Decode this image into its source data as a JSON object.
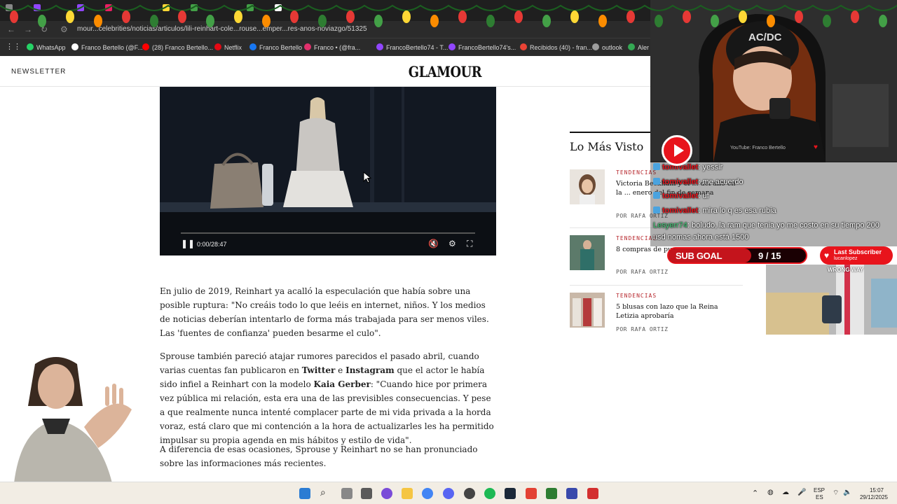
{
  "browser": {
    "url": "mour...celebrities/noticias/articulos/lili-reinhart-cole...rouse...emper...res-anos-noviazgo/51325",
    "bookmarks": [
      {
        "label": "WhatsApp",
        "icon": "whatsapp-icon",
        "color": "#25d366"
      },
      {
        "label": "Franco Bertello (@F...",
        "icon": "x-icon",
        "color": "#ffffff"
      },
      {
        "label": "(28) Franco Bertello...",
        "icon": "youtube-icon",
        "color": "#ff0000"
      },
      {
        "label": "Netflix",
        "icon": "netflix-icon",
        "color": "#e50914"
      },
      {
        "label": "Franco Bertello",
        "icon": "facebook-icon",
        "color": "#1877f2"
      },
      {
        "label": "Franco • (@fra...",
        "icon": "instagram-icon",
        "color": "#e1306c"
      },
      {
        "label": "FrancoBertello74 - T...",
        "icon": "twitch-icon",
        "color": "#9146ff"
      },
      {
        "label": "FrancoBertello74's...",
        "icon": "twitch-icon",
        "color": "#9146ff"
      },
      {
        "label": "Recibidos (40) - fran...",
        "icon": "gmail-icon",
        "color": "#ea4335"
      },
      {
        "label": "outlook",
        "icon": "globe-icon",
        "color": "#9e9e9e"
      },
      {
        "label": "Aler",
        "icon": "alert-icon",
        "color": "#34a853"
      }
    ]
  },
  "site": {
    "newsletter": "NEWSLETTER",
    "logo": "GLAMOUR"
  },
  "video": {
    "time": "0:00/28:47",
    "progress": 0.0
  },
  "article": {
    "p1": "En julio de 2019, Reinhart ya acalló la especulación que había sobre una posible ruptura: \"No creáis todo lo que leéis en internet, niños. Y los medios de noticias deberían intentarlo de forma más trabajada para ser menos viles. Las 'fuentes de confianza' pueden besarme el culo\".",
    "p2_a": "Sprouse también pareció atajar rumores parecidos el pasado abril, cuando varias cuentas fan publicaron en ",
    "p2_twitter": "Twitter",
    "p2_e": " e ",
    "p2_instagram": "Instagram",
    "p2_b": " que el actor le había sido infiel a Reinhart con la modelo ",
    "p2_kaia": "Kaia Gerber",
    "p2_c": ": \"Cuando hice por primera vez pública mi relación, esta era una de las previsibles consecuencias. Y pese a que realmente nunca intenté complacer parte de mi vida privada a la horda voraz, está claro que mi contención a la hora de actualizarles les ha permitido impulsar su propia agenda en mis hábitos y estilo de vida\".",
    "p3": "A diferencia de esas ocasiones, Sprouse y Reinhart no se han pronunciado sobre las informaciones más recientes."
  },
  "sidebar": {
    "title": "Lo Más Visto",
    "items": [
      {
        "category": "TENDENCIAS",
        "title": "Victoria Beckham y el ... del año en la ... enero del fin de semana",
        "byline": "POR RAFA ORTIZ"
      },
      {
        "category": "TENDENCIAS",
        "title": "8 compras de pun... enero",
        "byline": "POR RAFA ORTIZ"
      },
      {
        "category": "TENDENCIAS",
        "title": "5 blusas con lazo que la Reina Letizia aprobaría",
        "byline": "POR RAFA ORTIZ"
      }
    ]
  },
  "stream": {
    "yt_label": "YouTube: Franco Bertello",
    "chat": [
      {
        "user": "tomivallet",
        "msg": ": yessir",
        "style": "red"
      },
      {
        "user": "tomivallet",
        "msg": ": me acuerdo",
        "style": "red"
      },
      {
        "user": "tomivallet",
        "msg": ": uf",
        "style": "red"
      },
      {
        "user": "tomivallet",
        "msg": ": mira lo q es esa rubia",
        "style": "red"
      },
      {
        "user": "Lesyerr74",
        "msg": ": boludo, la ram que tenia yo me costo en su tiempo 200",
        "style": "green"
      },
      {
        "user": "",
        "msg": "usd nomas ahora está 1500",
        "style": "plain"
      }
    ],
    "sub_goal": {
      "label": "SUB GOAL",
      "count": "9 / 15",
      "current": 9,
      "target": 15
    },
    "last_subscriber": {
      "title": "Last Subscriber",
      "name": "lucanlopez"
    },
    "game_text": "WRONG WAY"
  },
  "taskbar": {
    "lang_top": "ESP",
    "lang_bottom": "ES",
    "time": "15:07",
    "date": "29/12/2025"
  }
}
